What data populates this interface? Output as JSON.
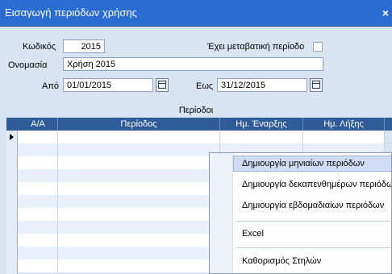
{
  "window": {
    "title": "Εισαγωγή περιόδων χρήσης",
    "close_label": "×"
  },
  "form": {
    "code_label": "Κωδικός",
    "code_value": "2015",
    "transitional_label": "Έχει μεταβατική περίοδο",
    "transitional_checked": false,
    "name_label": "Ονομασία",
    "name_value": "Χρήση 2015",
    "from_label": "Από",
    "from_value": "01/01/2015",
    "to_label": "Εως",
    "to_value": "31/12/2015"
  },
  "grid": {
    "caption": "Περίοδοι",
    "columns": [
      "Α/Α",
      "Περίοδος",
      "Ημ. Έναρξης",
      "Ημ. Λήξης"
    ]
  },
  "context_menu": {
    "items": [
      "Δημιουργία μηνιαίων περιόδων",
      "Δημιουργία δεκαπενθημέρων περιόδων",
      "Δημιουργία εβδομαδιαίων περιόδων",
      "Excel",
      "Καθορισμός Στηλών"
    ]
  }
}
